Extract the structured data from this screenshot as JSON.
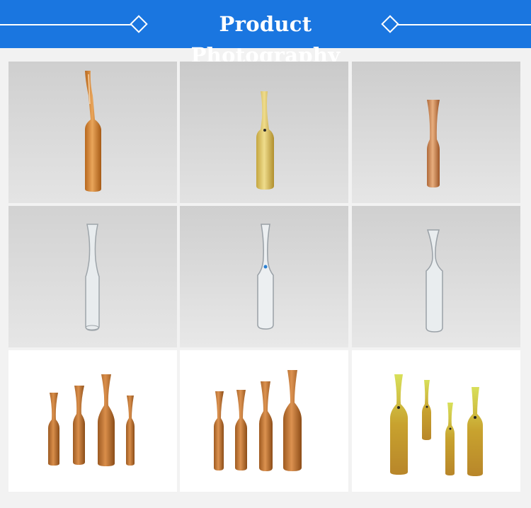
{
  "header": {
    "title": "Product Photography",
    "left_icon": "diamond-icon",
    "right_icon": "diamond-icon",
    "background": "#1a76e0"
  },
  "photos": [
    {
      "name": "amber-ampoule-single",
      "tone": "amber"
    },
    {
      "name": "yellow-ampoule-single",
      "tone": "yellow"
    },
    {
      "name": "amber-ampoule-narrow",
      "tone": "amber"
    },
    {
      "name": "clear-ampoule-single",
      "tone": "clear"
    },
    {
      "name": "clear-ampoule-dot",
      "tone": "clear"
    },
    {
      "name": "clear-ampoule-short",
      "tone": "clear"
    },
    {
      "name": "amber-ampoule-group-a",
      "tone": "amber"
    },
    {
      "name": "amber-ampoule-group-b",
      "tone": "amber"
    },
    {
      "name": "yellow-ampoule-group",
      "tone": "yellow"
    }
  ]
}
